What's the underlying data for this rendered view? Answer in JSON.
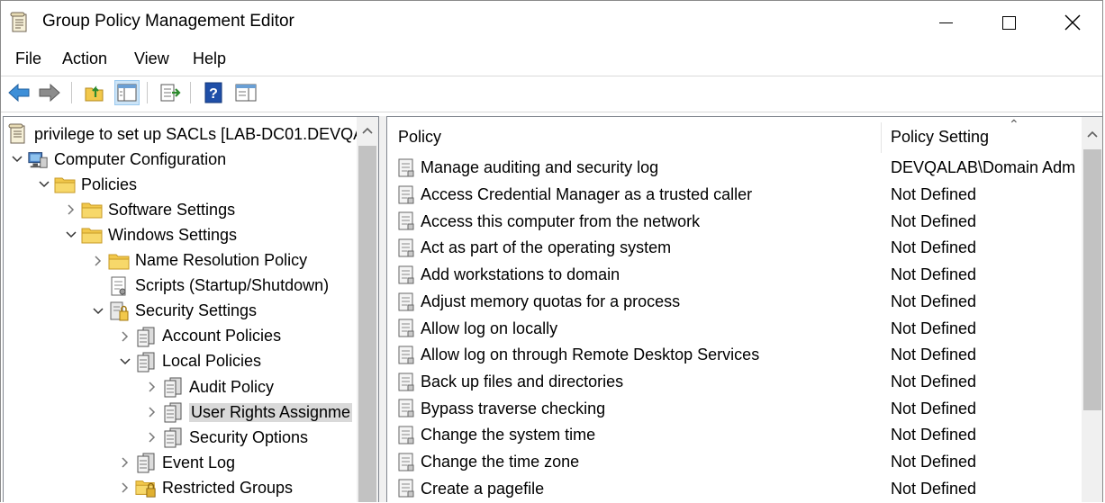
{
  "window": {
    "title": "Group Policy Management Editor"
  },
  "menu": [
    "File",
    "Action",
    "View",
    "Help"
  ],
  "toolbar": [
    "back-icon",
    "forward-icon",
    "up-folder-icon",
    "show-hide-tree-icon",
    "export-list-icon",
    "help-icon",
    "properties-pane-icon"
  ],
  "tree": [
    {
      "label": "privilege to set up SACLs [LAB-DC01.DEVQA",
      "level": 0,
      "expander": "none",
      "icon": "gpo-icon"
    },
    {
      "label": "Computer Configuration",
      "level": 0,
      "expander": "expanded",
      "icon": "computer-icon"
    },
    {
      "label": "Policies",
      "level": 1,
      "expander": "expanded",
      "icon": "folder-icon"
    },
    {
      "label": "Software Settings",
      "level": 2,
      "expander": "collapsed",
      "icon": "folder-icon"
    },
    {
      "label": "Windows Settings",
      "level": 2,
      "expander": "expanded",
      "icon": "folder-icon"
    },
    {
      "label": "Name Resolution Policy",
      "level": 3,
      "expander": "collapsed",
      "icon": "folder-icon"
    },
    {
      "label": "Scripts (Startup/Shutdown)",
      "level": 3,
      "expander": "none",
      "icon": "script-icon"
    },
    {
      "label": "Security Settings",
      "level": 3,
      "expander": "expanded",
      "icon": "security-icon"
    },
    {
      "label": "Account Policies",
      "level": 4,
      "expander": "collapsed",
      "icon": "policy-book-icon"
    },
    {
      "label": "Local Policies",
      "level": 4,
      "expander": "expanded",
      "icon": "policy-book-icon"
    },
    {
      "label": "Audit Policy",
      "level": 5,
      "expander": "collapsed",
      "icon": "policy-book-icon"
    },
    {
      "label": "User Rights Assignme",
      "level": 5,
      "expander": "collapsed",
      "icon": "policy-book-icon",
      "selected": true
    },
    {
      "label": "Security Options",
      "level": 5,
      "expander": "collapsed",
      "icon": "policy-book-icon"
    },
    {
      "label": "Event Log",
      "level": 4,
      "expander": "collapsed",
      "icon": "policy-book-icon"
    },
    {
      "label": "Restricted Groups",
      "level": 4,
      "expander": "collapsed",
      "icon": "restricted-folder-icon"
    }
  ],
  "list": {
    "columns": {
      "policy": "Policy",
      "setting": "Policy Setting"
    },
    "rows": [
      {
        "policy": "Manage auditing and security log",
        "setting": "DEVQALAB\\Domain Adm"
      },
      {
        "policy": "Access Credential Manager as a trusted caller",
        "setting": "Not Defined"
      },
      {
        "policy": "Access this computer from the network",
        "setting": "Not Defined"
      },
      {
        "policy": "Act as part of the operating system",
        "setting": "Not Defined"
      },
      {
        "policy": "Add workstations to domain",
        "setting": "Not Defined"
      },
      {
        "policy": "Adjust memory quotas for a process",
        "setting": "Not Defined"
      },
      {
        "policy": "Allow log on locally",
        "setting": "Not Defined"
      },
      {
        "policy": "Allow log on through Remote Desktop Services",
        "setting": "Not Defined"
      },
      {
        "policy": "Back up files and directories",
        "setting": "Not Defined"
      },
      {
        "policy": "Bypass traverse checking",
        "setting": "Not Defined"
      },
      {
        "policy": "Change the system time",
        "setting": "Not Defined"
      },
      {
        "policy": "Change the time zone",
        "setting": "Not Defined"
      },
      {
        "policy": "Create a pagefile",
        "setting": "Not Defined"
      }
    ]
  }
}
